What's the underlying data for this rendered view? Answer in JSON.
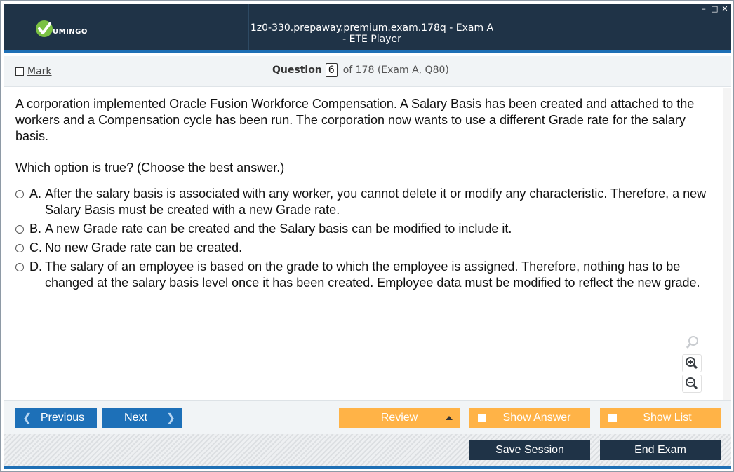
{
  "titlebar": {
    "logo_text": "UMINGO",
    "title": "1z0-330.prepaway.premium.exam.178q - Exam A - ETE Player",
    "controls": [
      "–",
      "□",
      "✕"
    ]
  },
  "qbar": {
    "mark_label": "Mark",
    "question_label": "Question",
    "question_number": "6",
    "question_of": "of 178 (Exam A, Q80)"
  },
  "content": {
    "question_text": "A corporation implemented Oracle Fusion Workforce Compensation. A Salary Basis has been created and attached to the workers and a Compensation cycle has been run. The corporation now wants to use a different Grade rate for the salary basis.",
    "prompt": "Which option is true? (Choose the best answer.)",
    "options": [
      {
        "letter": "A.",
        "text": "After the salary basis is associated with any worker, you cannot delete it or modify any characteristic. Therefore, a new Salary Basis must be created with a new Grade rate."
      },
      {
        "letter": "B.",
        "text": "A new Grade rate can be created and the Salary basis can be modified to include it."
      },
      {
        "letter": "C.",
        "text": "No new Grade rate can be created."
      },
      {
        "letter": "D.",
        "text": "The salary of an employee is based on the grade to which the employee is assigned. Therefore, nothing has to be changed at the salary basis level once it has been created. Employee data must be modified to reflect the new grade."
      }
    ],
    "zoom_icons": [
      "search-icon",
      "zoom-in-icon",
      "zoom-out-icon"
    ]
  },
  "navbar": {
    "previous_label": "Previous",
    "next_label": "Next",
    "review_label": "Review",
    "show_answer_label": "Show Answer",
    "show_list_label": "Show List"
  },
  "bottombar": {
    "save_session_label": "Save Session",
    "end_exam_label": "End Exam"
  },
  "colors": {
    "titlebar_bg": "#1f3347",
    "accent_blue": "#1d70b8",
    "accent_orange": "#ffb347",
    "logo_green": "#7ac143"
  }
}
